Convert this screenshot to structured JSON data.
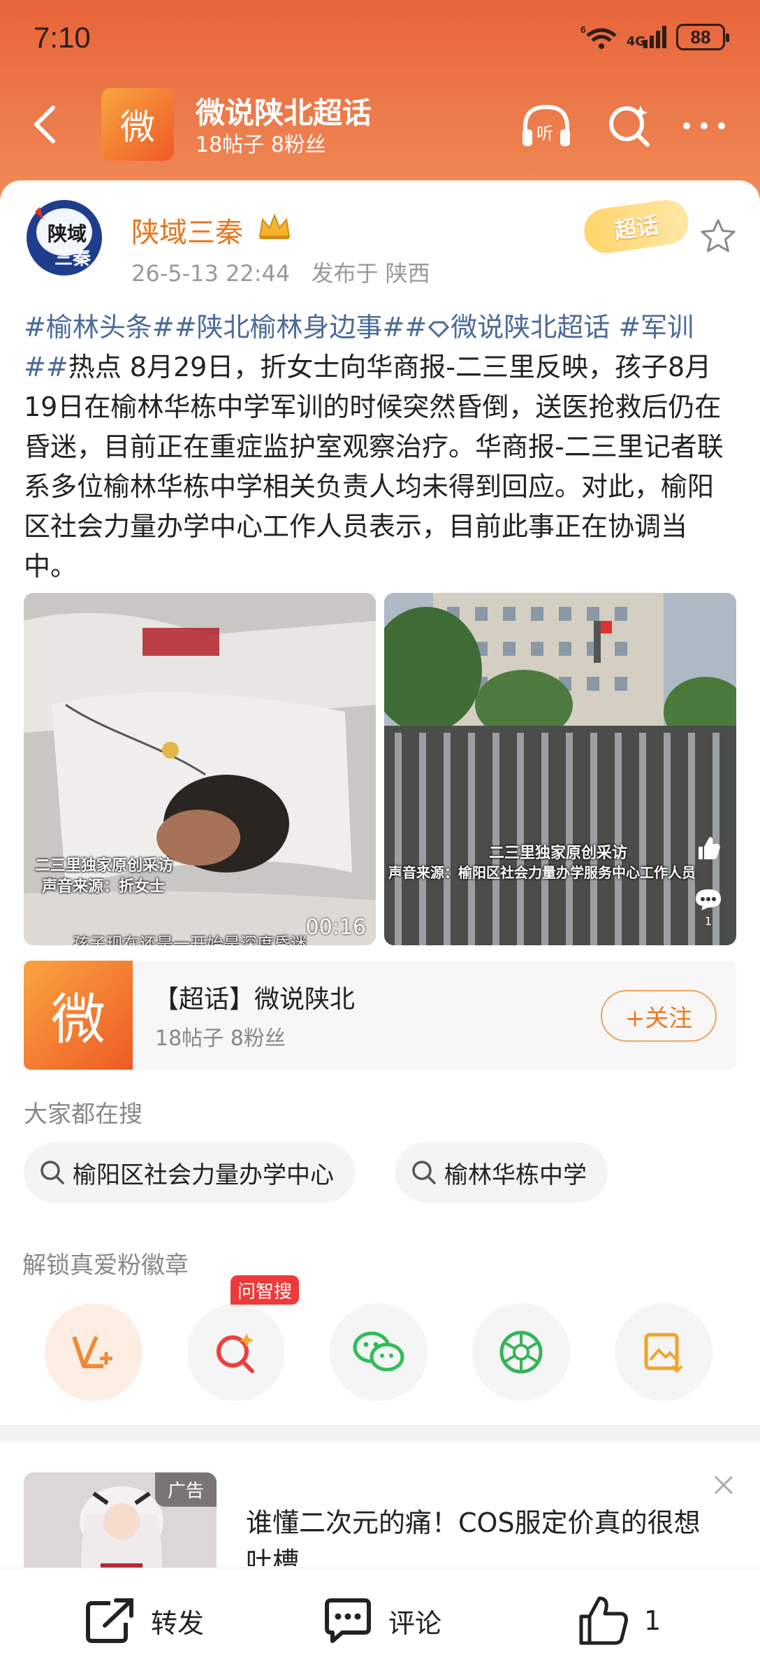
{
  "status_bar": {
    "time": "7:10",
    "network": "4G",
    "signal_num": "6",
    "battery": "88"
  },
  "nav": {
    "logo_char": "微",
    "title": "微说陕北超话",
    "subtitle": "18帖子 8粉丝"
  },
  "post": {
    "author": "陕域三秦",
    "timestamp": "26-5-13 22:44",
    "location": "发布于 陕西",
    "super_badge": "超话",
    "tags": [
      "#榆林头条#",
      "#陕北榆林身边事#",
      "微说陕北超话",
      " #军训#"
    ],
    "body": "热点 8月29日，折女士向华商报-二三里反映，孩子8月19日在榆林华栋中学军训的时候突然昏倒，送医抢救后仍在昏迷，目前正在重症监护室观察治疗。华商报-二三里记者联系多位榆林华栋中学相关负责人均未得到回应。对此，榆阳区社会力量办学中心工作人员表示，目前此事正在协调当中。",
    "media1": {
      "caption1": "二三里独家原创采访",
      "caption2": "声音来源：折女士",
      "subtitle": "孩子现在还是一开始是深度昏迷",
      "duration": "00:16"
    },
    "media2": {
      "caption1": "二三里独家原创采访",
      "caption2": "声音来源：榆阳区社会力量办学服务中心工作人员",
      "comment_count": "1"
    }
  },
  "topic": {
    "logo_char": "微",
    "title": "【超话】微说陕北",
    "stats": "18帖子 8粉丝",
    "follow_label": "+关注"
  },
  "search": {
    "header": "大家都在搜",
    "items": [
      "榆阳区社会力量办学中心",
      "榆林华栋中学"
    ]
  },
  "badge_section": {
    "header": "解锁真爱粉徽章",
    "wenzhisou": "问智搜"
  },
  "ad": {
    "tag": "广告",
    "text": "谁懂二次元的痛！COS服定价真的很想吐槽"
  },
  "bottom_bar": {
    "repost": "转发",
    "comment": "评论",
    "like_count": "1"
  },
  "colors": {
    "accent": "#ee7a21",
    "header": "#e8633a",
    "tag": "#4a6a98"
  }
}
